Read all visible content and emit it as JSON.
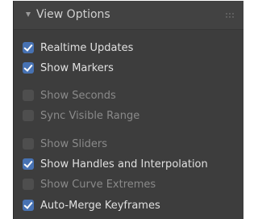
{
  "panel": {
    "title": "View Options",
    "collapse_icon": "chevron-down-icon",
    "drag_icon": "grip-dots-icon"
  },
  "options": [
    {
      "label": "Realtime Updates",
      "checked": true
    },
    {
      "label": "Show Markers",
      "checked": true
    },
    {
      "label": "Show Seconds",
      "checked": false
    },
    {
      "label": "Sync Visible Range",
      "checked": false
    },
    {
      "label": "Show Sliders",
      "checked": false
    },
    {
      "label": "Show Handles and Interpolation",
      "checked": true
    },
    {
      "label": "Show Curve Extremes",
      "checked": false
    },
    {
      "label": "Auto-Merge Keyframes",
      "checked": true
    }
  ],
  "colors": {
    "panel_bg": "#3d3d3d",
    "checkbox_on": "#4772b3",
    "checkbox_off": "#4e4e4e",
    "text_on": "#e0e0e0",
    "text_off": "#8a8a8a"
  }
}
